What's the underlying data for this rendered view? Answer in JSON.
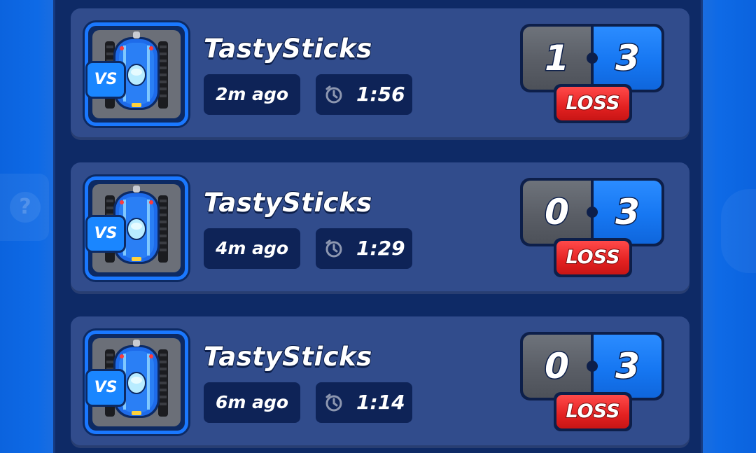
{
  "matches": [
    {
      "player_name": "TastySticks",
      "vs_label": "VS",
      "time_ago": "2m ago",
      "duration": "1:56",
      "score_player": "1",
      "score_opponent": "3",
      "result": "LOSS"
    },
    {
      "player_name": "TastySticks",
      "vs_label": "VS",
      "time_ago": "4m ago",
      "duration": "1:29",
      "score_player": "0",
      "score_opponent": "3",
      "result": "LOSS"
    },
    {
      "player_name": "TastySticks",
      "vs_label": "VS",
      "time_ago": "6m ago",
      "duration": "1:14",
      "score_player": "0",
      "score_opponent": "3",
      "result": "LOSS"
    }
  ],
  "icons": {
    "help": "question-icon",
    "timer": "stopwatch-icon",
    "avatar": "robot-avatar-icon"
  },
  "colors": {
    "loss": "#e32121",
    "player_side": "#5a5e66",
    "opponent_side": "#1677f2",
    "card": "#314c8c",
    "panel": "#0e2a66"
  }
}
